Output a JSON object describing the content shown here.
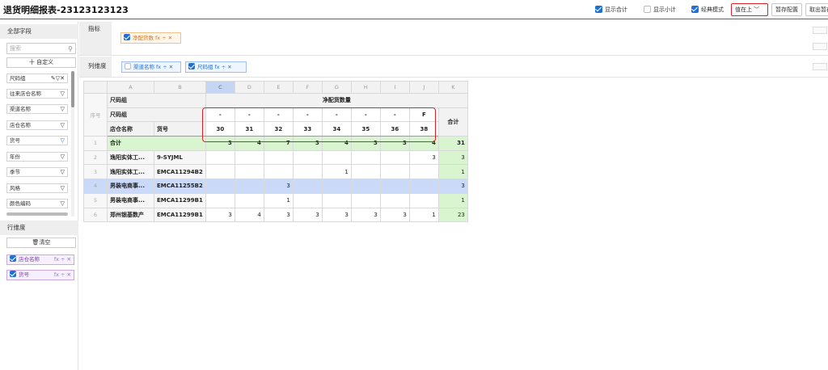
{
  "header": {
    "title": "退货明细报表-23123123123",
    "show_total": "显示合计",
    "show_subtotal": "显示小计",
    "classic_mode": "经典模式",
    "value_position": "值在上",
    "save_config": "暂存配置",
    "cancel_save": "取出暂存"
  },
  "sidebar": {
    "all_fields_title": "全部字段",
    "search_placeholder": "搜索",
    "custom_button": "十 自定义",
    "fields": [
      "尺码组",
      "往来店仓名称",
      "渠道名称",
      "店仓名称",
      "货号",
      "年份",
      "季节",
      "风格",
      "颜色编码"
    ],
    "row_dim_title": "行维度",
    "clear_button": "清空",
    "row_dims": [
      "店仓名称",
      "货号"
    ]
  },
  "metric_row": {
    "label": "指标",
    "chips": [
      "净配货数"
    ]
  },
  "column_row": {
    "label": "列维度",
    "chips": [
      "渠道名称",
      "尺码组"
    ]
  },
  "chip_icons": "fx ÷ ✕",
  "table": {
    "col_letters": [
      "A",
      "B",
      "C",
      "D",
      "E",
      "F",
      "G",
      "H",
      "I",
      "J",
      "K"
    ],
    "seq_label": "序号",
    "size_group_label": "尺码组",
    "measure_label": "净配货数量",
    "store_label": "店仓名称",
    "sku_label": "货号",
    "dash_row": [
      "-",
      "-",
      "-",
      "-",
      "-",
      "-",
      "-",
      "F"
    ],
    "sizes": [
      "30",
      "31",
      "32",
      "33",
      "34",
      "35",
      "36",
      "38"
    ],
    "total_col_label": "合计",
    "total_row_label": "合计",
    "total_row": [
      "3",
      "4",
      "7",
      "3",
      "4",
      "3",
      "3",
      "4",
      "31"
    ],
    "rows": [
      {
        "n": "2",
        "store": "逸阳实体工...",
        "sku": "9-SYJML",
        "vals": [
          "",
          "",
          "",
          "",
          "",
          "",
          "",
          "3"
        ],
        "sum": "3"
      },
      {
        "n": "3",
        "store": "逸阳实体工...",
        "sku": "EMCA11294B2",
        "vals": [
          "",
          "",
          "",
          "",
          "1",
          "",
          "",
          ""
        ],
        "sum": "1"
      },
      {
        "n": "4",
        "store": "男装电商事...",
        "sku": "EMCA11255B2",
        "vals": [
          "",
          "",
          "3",
          "",
          "",
          "",
          "",
          ""
        ],
        "sum": "3"
      },
      {
        "n": "5",
        "store": "男装电商事...",
        "sku": "EMCA11299B1",
        "vals": [
          "",
          "",
          "1",
          "",
          "",
          "",
          "",
          ""
        ],
        "sum": "1"
      },
      {
        "n": "6",
        "store": "郑州银基数产",
        "sku": "EMCA11299B1",
        "vals": [
          "3",
          "4",
          "3",
          "3",
          "3",
          "3",
          "3",
          "1"
        ],
        "sum": "23"
      }
    ],
    "row1_n": "1"
  }
}
